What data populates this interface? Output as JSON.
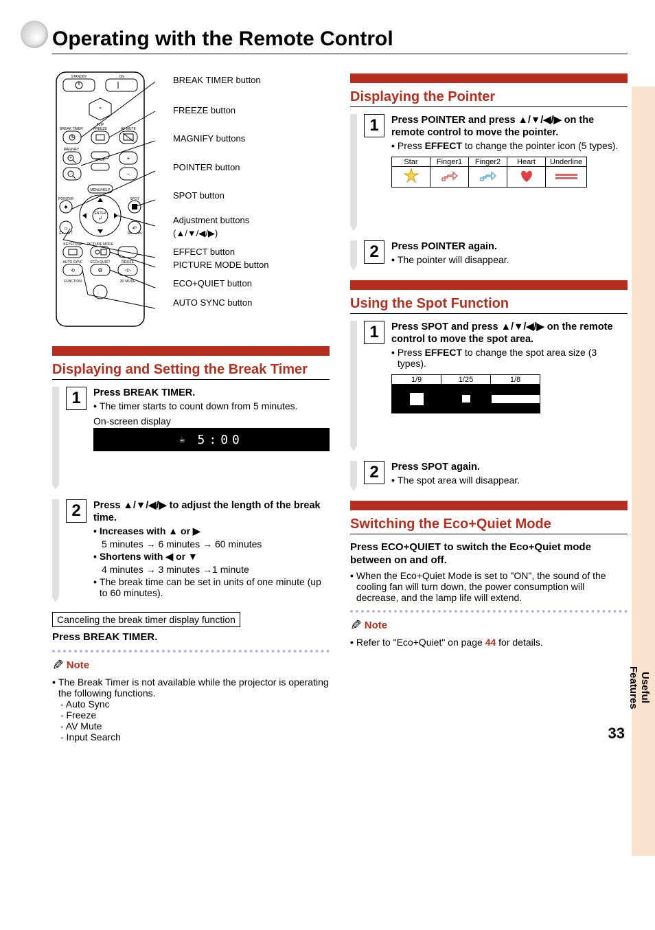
{
  "page_title": "Operating with the Remote Control",
  "page_number": "33",
  "side_tab": "Useful\nFeatures",
  "remote_labels": [
    "BREAK TIMER button",
    "FREEZE button",
    "MAGNIFY buttons",
    "POINTER button",
    "SPOT button",
    "Adjustment buttons",
    "(▲/▼/◀/▶)",
    "EFFECT button",
    "PICTURE MODE button",
    "ECO+QUIET button",
    "AUTO SYNC button"
  ],
  "break_timer": {
    "heading": "Displaying and Setting the Break Timer",
    "step1_title_a": "Press ",
    "step1_title_b": "BREAK TIMER",
    "step1_title_c": ".",
    "step1_bullet": "The timer starts to count down from 5 minutes.",
    "osd_caption": "On-screen display",
    "osd_value": "5:00",
    "step2_title": "Press ▲/▼/◀/▶ to adjust the length of the break time.",
    "step2_inc_label": "Increases with ▲ or ▶",
    "step2_inc_text": "5 minutes → 6 minutes → 60 minutes",
    "step2_dec_label": "Shortens with ◀ or ▼",
    "step2_dec_text": "4 minutes → 3 minutes →1 minute",
    "step2_bullet2": "The break time can be set in units of one minute (up to 60 minutes).",
    "cancel_box": "Canceling the break timer display function",
    "cancel_press_a": "Press ",
    "cancel_press_b": "BREAK TIMER",
    "cancel_press_c": ".",
    "note_label": "Note",
    "note_bullet": "The Break Timer is not available while the projector is operating the following functions.",
    "note_items": [
      "- Auto Sync",
      "- Freeze",
      "- AV Mute",
      "- Input Search"
    ]
  },
  "pointer": {
    "heading": "Displaying the Pointer",
    "step1_title": "Press POINTER and press ▲/▼/◀/▶ on the remote control to move the pointer.",
    "step1_title_a": "Press ",
    "step1_title_b": "POINTER",
    "step1_title_c": " and press ▲/▼/◀/▶ on the remote control to move the pointer.",
    "step1_bullet_a": "Press ",
    "step1_bullet_b": "EFFECT",
    "step1_bullet_c": " to change the pointer icon (5 types).",
    "table_headers": [
      "Star",
      "Finger1",
      "Finger2",
      "Heart",
      "Underline"
    ],
    "step2_title_a": "Press ",
    "step2_title_b": "POINTER",
    "step2_title_c": " again.",
    "step2_bullet": "The pointer will disappear."
  },
  "spot": {
    "heading": "Using the Spot Function",
    "step1_title_a": "Press ",
    "step1_title_b": "SPOT",
    "step1_title_c": " and press ▲/▼/◀/▶ on the remote control to move the spot area.",
    "step1_bullet_a": "Press ",
    "step1_bullet_b": "EFFECT",
    "step1_bullet_c": " to change the spot area size (3 types).",
    "table_headers": [
      "1/9",
      "1/25",
      "1/8"
    ],
    "step2_title_a": "Press ",
    "step2_title_b": "SPOT",
    "step2_title_c": " again.",
    "step2_bullet": "The spot area will disappear."
  },
  "eco": {
    "heading": "Switching the Eco+Quiet Mode",
    "press_a": "Press ",
    "press_b": "ECO+QUIET",
    "press_c": " to switch the Eco+Quiet mode between on and off.",
    "bullet": "When the Eco+Quiet Mode is set to \"ON\", the sound of the cooling fan will turn down, the power consumption will decrease, and the lamp life will extend.",
    "note_label": "Note",
    "note_text_a": "Refer to \"Eco+Quiet\" on page ",
    "note_page": "44",
    "note_text_b": " for details."
  }
}
